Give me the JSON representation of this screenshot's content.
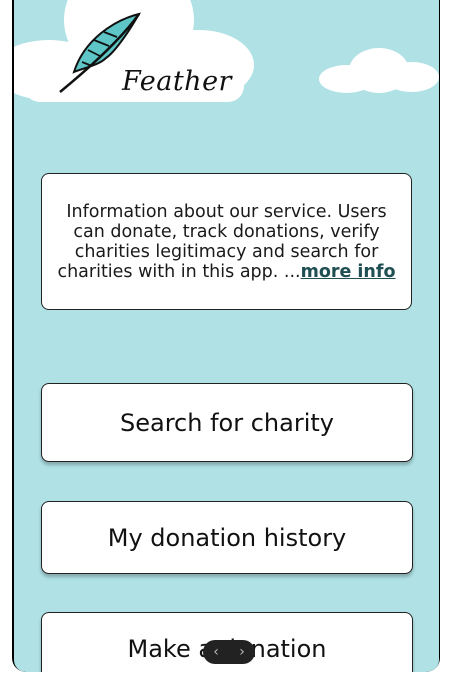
{
  "app": {
    "name": "Feather"
  },
  "info": {
    "text": "Information about our service. Users can donate, track donations, verify charities legitimacy and search for charities with in this app. ...",
    "more_label": "more info"
  },
  "buttons": {
    "search": "Search for charity",
    "history": "My donation history",
    "donate": "Make a donation"
  },
  "nav": {
    "back_glyph": "‹",
    "forward_glyph": "›"
  },
  "colors": {
    "background": "#afe1e5",
    "logo_feather": "#5ec6c6",
    "link": "#1f4f52"
  }
}
